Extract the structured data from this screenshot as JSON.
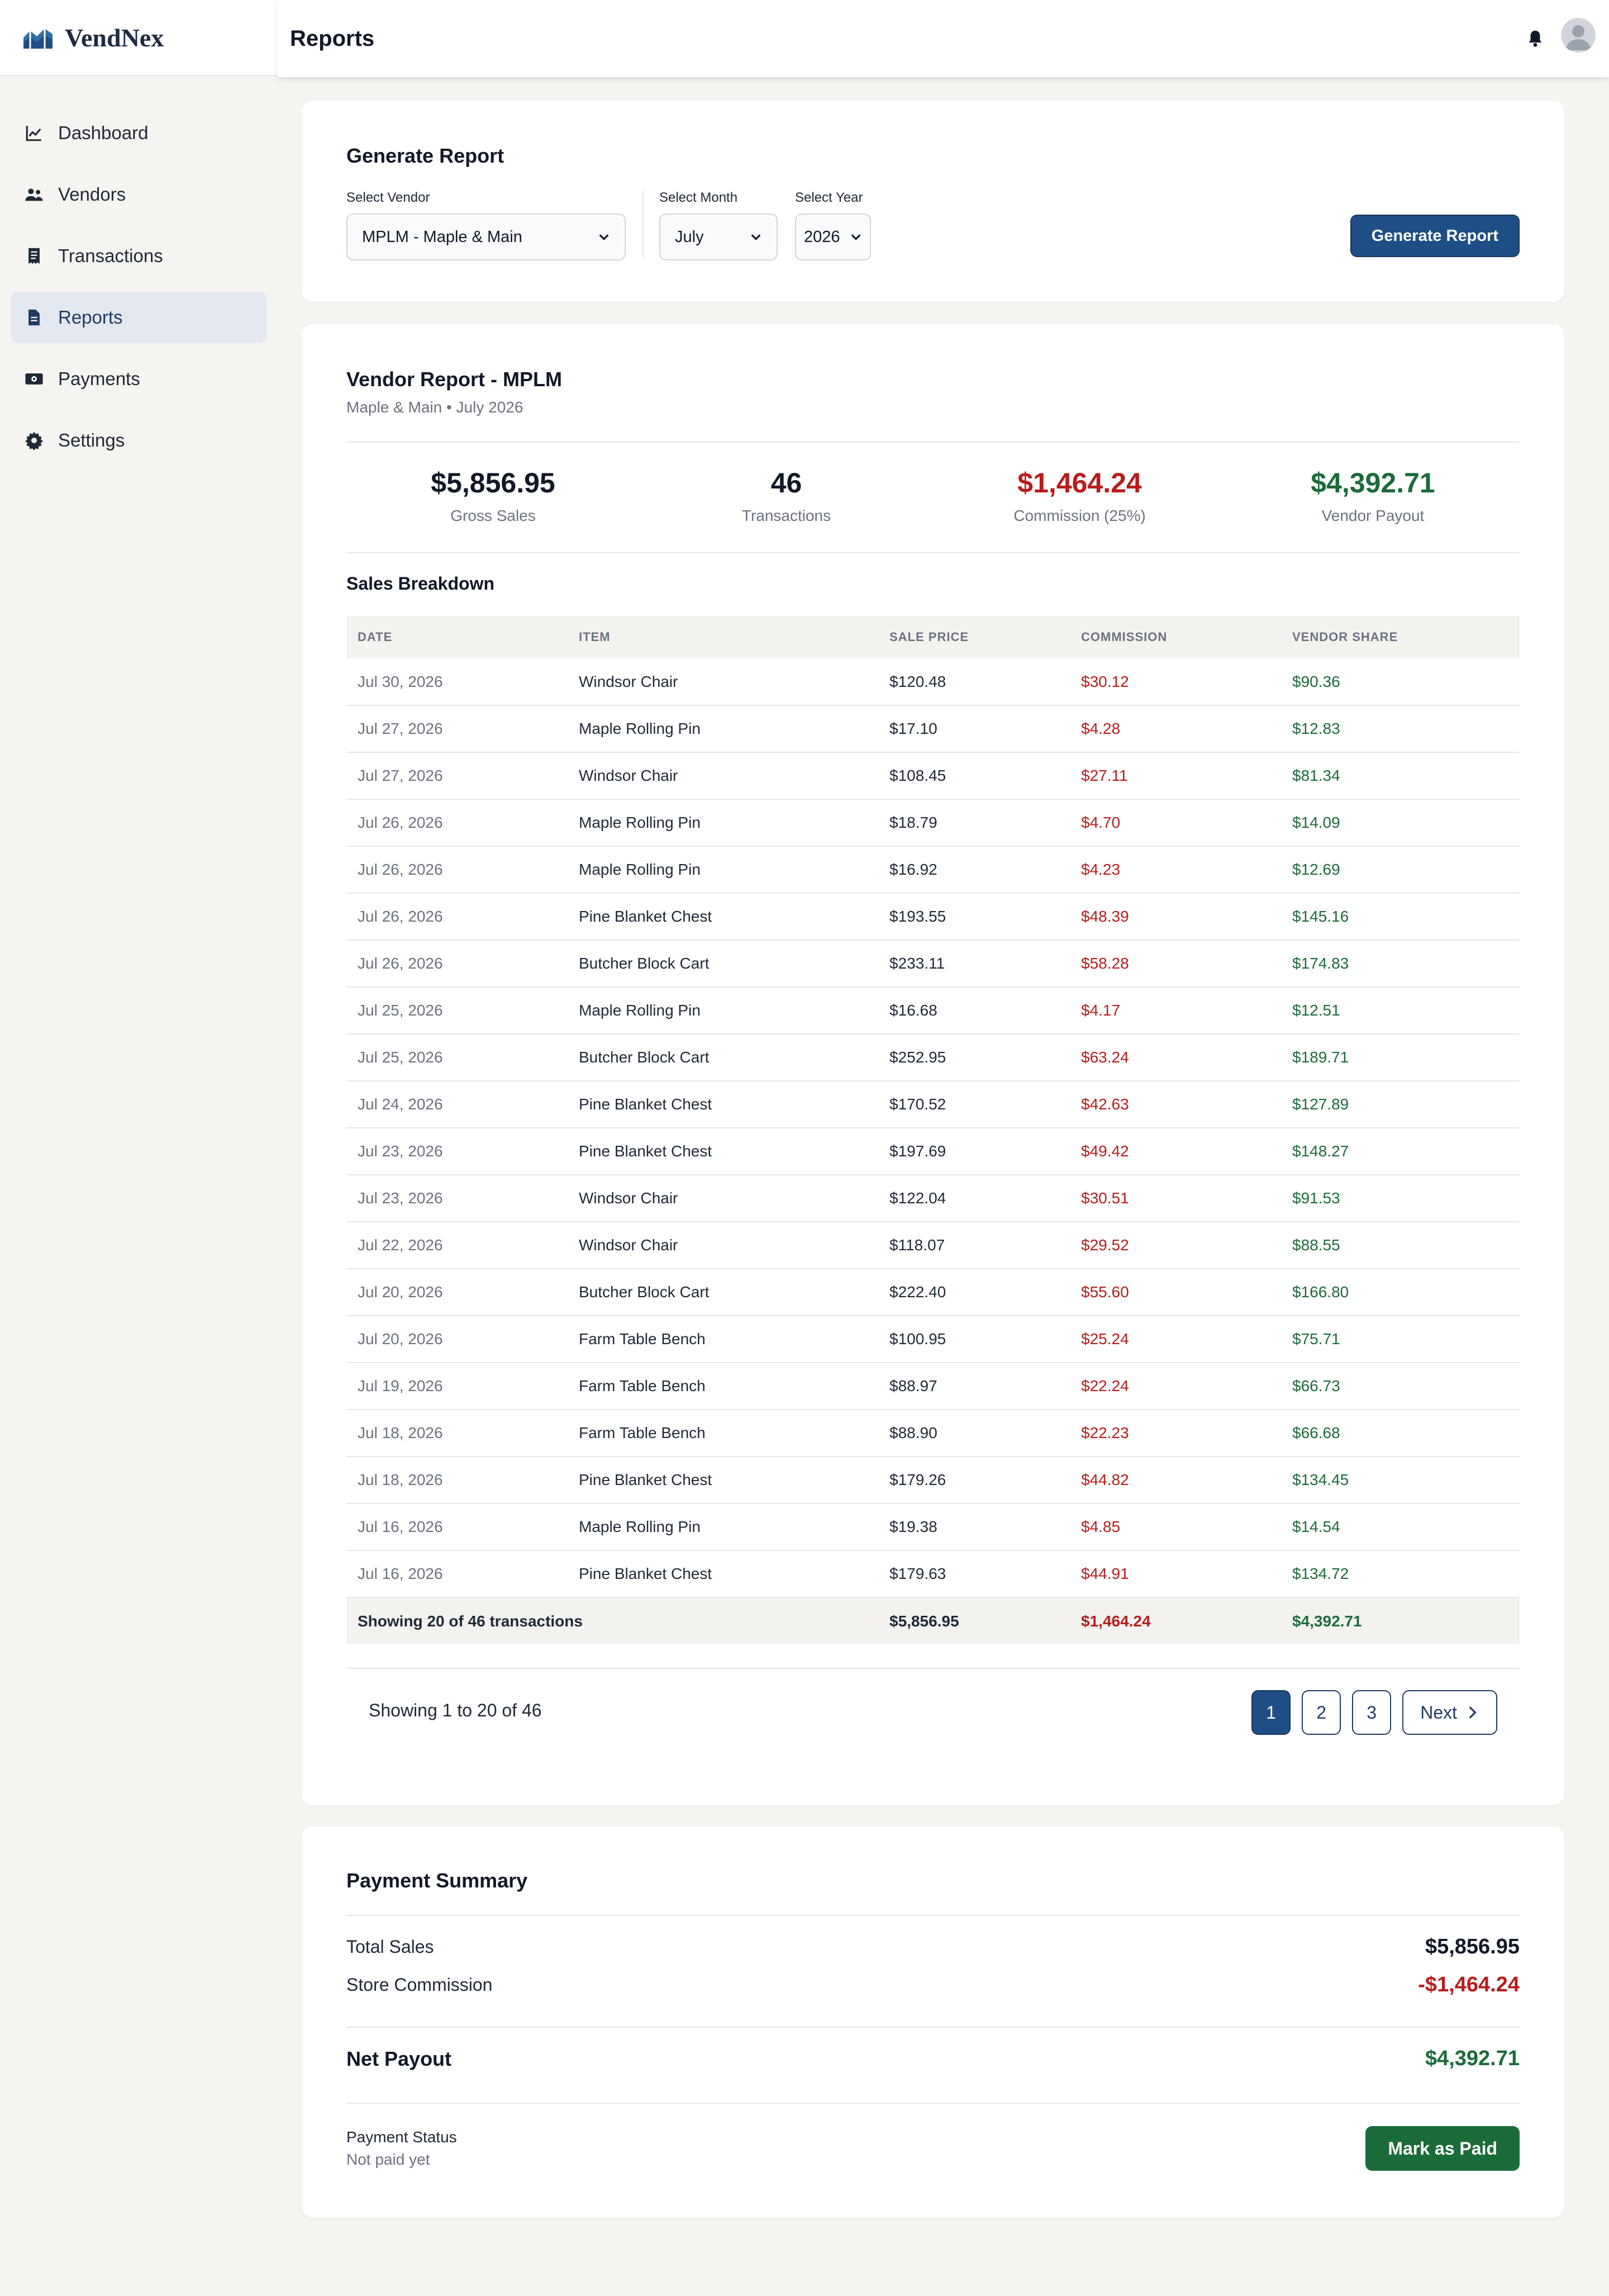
{
  "app": {
    "name": "VendNex"
  },
  "header": {
    "title": "Reports"
  },
  "sidebar": {
    "items": [
      {
        "label": "Dashboard",
        "icon": "chart-line-icon"
      },
      {
        "label": "Vendors",
        "icon": "users-icon"
      },
      {
        "label": "Transactions",
        "icon": "receipt-icon"
      },
      {
        "label": "Reports",
        "icon": "file-icon",
        "active": true
      },
      {
        "label": "Payments",
        "icon": "money-icon"
      },
      {
        "label": "Settings",
        "icon": "gear-icon"
      }
    ]
  },
  "generate": {
    "title": "Generate Report",
    "vendor_label": "Select Vendor",
    "vendor_value": "MPLM - Maple & Main",
    "month_label": "Select Month",
    "month_value": "July",
    "year_label": "Select Year",
    "year_value": "2026",
    "button": "Generate Report"
  },
  "report": {
    "title": "Vendor Report - MPLM",
    "subtitle": "Maple & Main • July 2026",
    "stats": {
      "gross_value": "$5,856.95",
      "gross_label": "Gross Sales",
      "tx_value": "46",
      "tx_label": "Transactions",
      "comm_value": "$1,464.24",
      "comm_label": "Commission (25%)",
      "payout_value": "$4,392.71",
      "payout_label": "Vendor Payout"
    },
    "breakdown_title": "Sales Breakdown",
    "columns": {
      "date": "DATE",
      "item": "ITEM",
      "price": "SALE PRICE",
      "commission": "COMMISSION",
      "share": "VENDOR SHARE"
    },
    "rows": [
      {
        "date": "Jul 30, 2026",
        "item": "Windsor Chair",
        "price": "$120.48",
        "commission": "$30.12",
        "share": "$90.36"
      },
      {
        "date": "Jul 27, 2026",
        "item": "Maple Rolling Pin",
        "price": "$17.10",
        "commission": "$4.28",
        "share": "$12.83"
      },
      {
        "date": "Jul 27, 2026",
        "item": "Windsor Chair",
        "price": "$108.45",
        "commission": "$27.11",
        "share": "$81.34"
      },
      {
        "date": "Jul 26, 2026",
        "item": "Maple Rolling Pin",
        "price": "$18.79",
        "commission": "$4.70",
        "share": "$14.09"
      },
      {
        "date": "Jul 26, 2026",
        "item": "Maple Rolling Pin",
        "price": "$16.92",
        "commission": "$4.23",
        "share": "$12.69"
      },
      {
        "date": "Jul 26, 2026",
        "item": "Pine Blanket Chest",
        "price": "$193.55",
        "commission": "$48.39",
        "share": "$145.16"
      },
      {
        "date": "Jul 26, 2026",
        "item": "Butcher Block Cart",
        "price": "$233.11",
        "commission": "$58.28",
        "share": "$174.83"
      },
      {
        "date": "Jul 25, 2026",
        "item": "Maple Rolling Pin",
        "price": "$16.68",
        "commission": "$4.17",
        "share": "$12.51"
      },
      {
        "date": "Jul 25, 2026",
        "item": "Butcher Block Cart",
        "price": "$252.95",
        "commission": "$63.24",
        "share": "$189.71"
      },
      {
        "date": "Jul 24, 2026",
        "item": "Pine Blanket Chest",
        "price": "$170.52",
        "commission": "$42.63",
        "share": "$127.89"
      },
      {
        "date": "Jul 23, 2026",
        "item": "Pine Blanket Chest",
        "price": "$197.69",
        "commission": "$49.42",
        "share": "$148.27"
      },
      {
        "date": "Jul 23, 2026",
        "item": "Windsor Chair",
        "price": "$122.04",
        "commission": "$30.51",
        "share": "$91.53"
      },
      {
        "date": "Jul 22, 2026",
        "item": "Windsor Chair",
        "price": "$118.07",
        "commission": "$29.52",
        "share": "$88.55"
      },
      {
        "date": "Jul 20, 2026",
        "item": "Butcher Block Cart",
        "price": "$222.40",
        "commission": "$55.60",
        "share": "$166.80"
      },
      {
        "date": "Jul 20, 2026",
        "item": "Farm Table Bench",
        "price": "$100.95",
        "commission": "$25.24",
        "share": "$75.71"
      },
      {
        "date": "Jul 19, 2026",
        "item": "Farm Table Bench",
        "price": "$88.97",
        "commission": "$22.24",
        "share": "$66.73"
      },
      {
        "date": "Jul 18, 2026",
        "item": "Farm Table Bench",
        "price": "$88.90",
        "commission": "$22.23",
        "share": "$66.68"
      },
      {
        "date": "Jul 18, 2026",
        "item": "Pine Blanket Chest",
        "price": "$179.26",
        "commission": "$44.82",
        "share": "$134.45"
      },
      {
        "date": "Jul 16, 2026",
        "item": "Maple Rolling Pin",
        "price": "$19.38",
        "commission": "$4.85",
        "share": "$14.54"
      },
      {
        "date": "Jul 16, 2026",
        "item": "Pine Blanket Chest",
        "price": "$179.63",
        "commission": "$44.91",
        "share": "$134.72"
      }
    ],
    "footer": {
      "label": "Showing 20 of 46 transactions",
      "price": "$5,856.95",
      "commission": "$1,464.24",
      "share": "$4,392.71"
    },
    "pagination": {
      "summary": "Showing 1 to 20 of 46",
      "pages": [
        "1",
        "2",
        "3"
      ],
      "next": "Next"
    }
  },
  "payment": {
    "title": "Payment Summary",
    "total_label": "Total Sales",
    "total_value": "$5,856.95",
    "commission_label": "Store Commission",
    "commission_value": "-$1,464.24",
    "net_label": "Net Payout",
    "net_value": "$4,392.71",
    "status_label": "Payment Status",
    "status_value": "Not paid yet",
    "button": "Mark as Paid"
  },
  "colors": {
    "primary": "#1f4e86",
    "negative": "#b91c1c",
    "positive": "#1c6b3a"
  }
}
